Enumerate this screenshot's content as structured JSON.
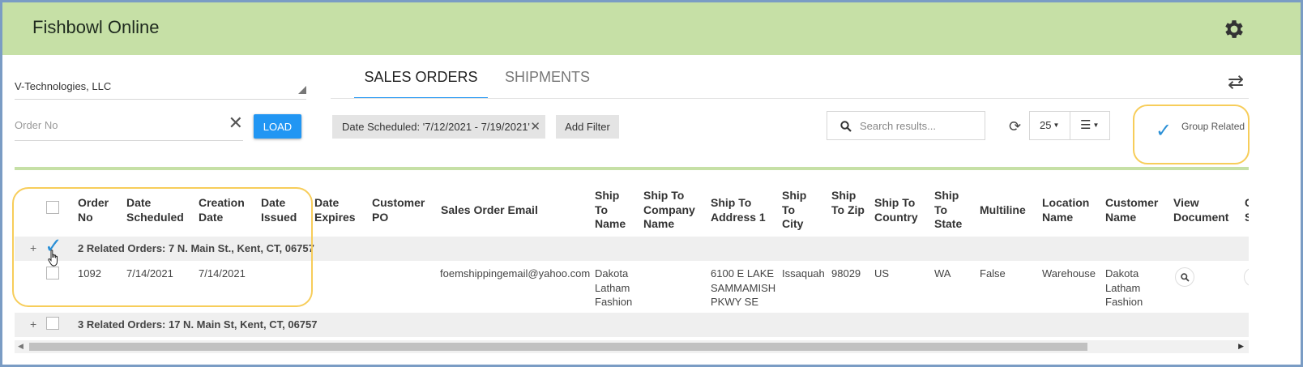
{
  "app": {
    "title": "Fishbowl Online"
  },
  "company": {
    "label": "V-Technologies, LLC"
  },
  "order_search": {
    "placeholder": "Order No",
    "value": "",
    "load_label": "LOAD"
  },
  "tabs": [
    {
      "label": "SALES ORDERS",
      "active": true
    },
    {
      "label": "SHIPMENTS",
      "active": false
    }
  ],
  "filters": {
    "chip": "Date Scheduled: '7/12/2021 - 7/19/2021'",
    "add_label": "Add Filter"
  },
  "search": {
    "placeholder": "Search results..."
  },
  "page_size": "25",
  "group_related": {
    "label": "Group Related",
    "checked": true
  },
  "table": {
    "headers": {
      "order_no": "Order No",
      "date_scheduled": "Date Scheduled",
      "creation_date": "Creation Date",
      "date_issued": "Date Issued",
      "date_expires": "Date Expires",
      "customer_po": "Customer PO",
      "sales_order_email": "Sales Order Email",
      "ship_to_name": "Ship To Name",
      "ship_to_company": "Ship To Company Name",
      "ship_to_address": "Ship To Address 1",
      "ship_to_city": "Ship To City",
      "ship_to_zip": "Ship To Zip",
      "ship_to_country": "Ship To Country",
      "ship_to_state": "Ship To State",
      "multiline": "Multiline",
      "location_name": "Location Name",
      "customer_name": "Customer Name",
      "view_document": "View Document",
      "partial": "C S"
    },
    "groups": [
      {
        "label": "2 Related Orders: 7 N. Main St., Kent, CT, 06757",
        "checked": true,
        "expand": "+"
      },
      {
        "label": "3 Related Orders: 17 N. Main St, Kent, CT, 06757",
        "checked": false,
        "expand": "+"
      }
    ],
    "row": {
      "order_no": "1092",
      "date_scheduled": "7/14/2021",
      "creation_date": "7/14/2021",
      "sales_order_email": "foemshippingemail@yahoo.com",
      "ship_to_name": "Dakota Latham Fashion",
      "ship_to_address": "6100 E LAKE SAMMAMISH PKWY SE",
      "ship_to_city": "Issaquah",
      "ship_to_zip": "98029",
      "ship_to_country": "US",
      "ship_to_state": "WA",
      "multiline": "False",
      "location_name": "Warehouse",
      "customer_name": "Dakota Latham Fashion"
    }
  },
  "icons": {
    "settings": "gear-icon",
    "swap": "swap-icon",
    "search": "search-icon",
    "refresh": "refresh-icon",
    "view": "list-view-icon"
  },
  "colors": {
    "header_bg": "#c6e0a6",
    "accent": "#2196f3",
    "highlight": "#f7cd5a",
    "check": "#2a8fd6"
  }
}
